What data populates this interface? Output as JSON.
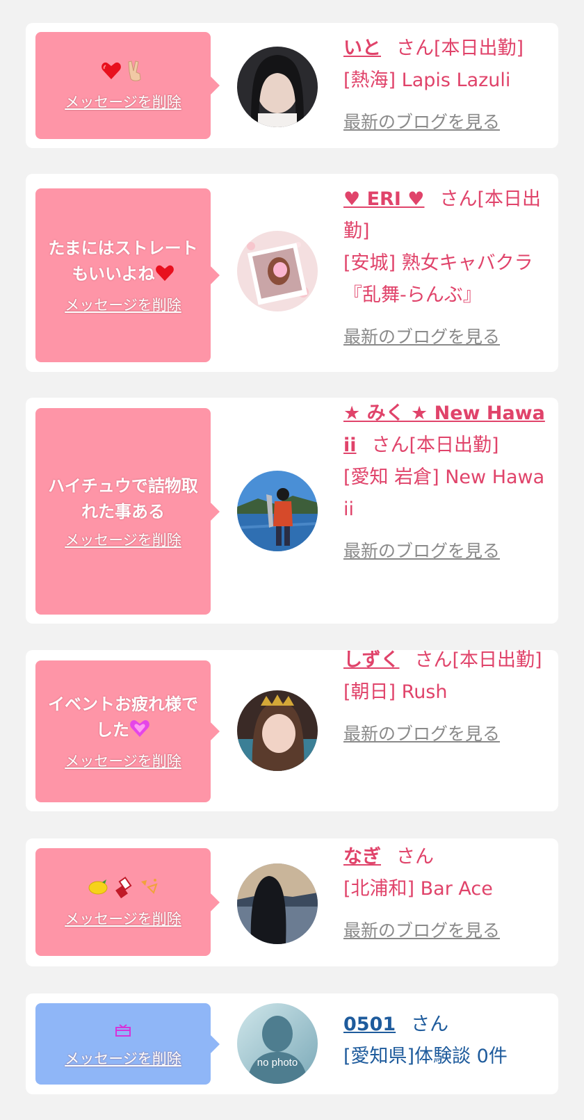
{
  "colors": {
    "pink_bubble": "#fe95a7",
    "blue_bubble": "#8fb6f7",
    "name_pink": "#e0436a",
    "name_blue": "#1e5b9c",
    "blog_gray": "#8a8a8a"
  },
  "delete_label": "メッセージを削除",
  "blog_label": "最新のブログを見る",
  "san_label": "さん",
  "cards": [
    {
      "message_icons": [
        "heart-icon",
        "victory-hand-icon"
      ],
      "name": "いと",
      "status": "[本日出勤]",
      "shop": "[熱海] Lapis Lazuli"
    },
    {
      "message": "たまにはストレートもいいよね",
      "message_icons": [
        "heart-icon"
      ],
      "name": "♥ ERI ♥",
      "status": "[本日出勤]",
      "shop": "[安城] 熟女キャバクラ『乱舞-らんぶ』"
    },
    {
      "message": "ハイチュウで詰物取れた事ある",
      "name": "★ みく ★ New Hawaii",
      "status": "[本日出勤]",
      "shop": "[愛知 岩倉] New Hawaii"
    },
    {
      "message": "イベントお疲れ様でした",
      "message_icons": [
        "sparkling-heart-icon"
      ],
      "name": "しずく",
      "status": "[本日出勤]",
      "shop": "[朝日] Rush"
    },
    {
      "message_icons": [
        "lemon-icon",
        "lipstick-icon",
        "sparkle-icon"
      ],
      "name": "なぎ",
      "status": "",
      "shop": "[北浦和] Bar Ace"
    },
    {
      "message_icons": [
        "gift-icon"
      ],
      "name": "0501",
      "status": "",
      "shop": "[愛知県]体験談 0件",
      "avatar_text": "no photo"
    }
  ]
}
